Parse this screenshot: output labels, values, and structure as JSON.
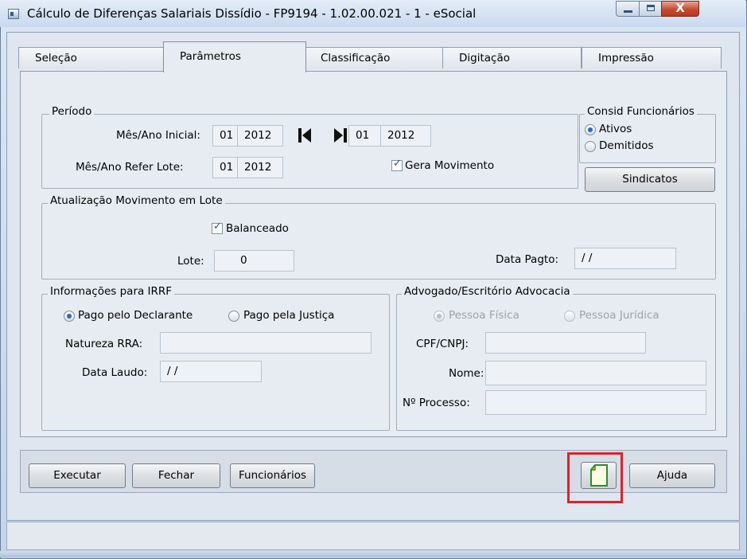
{
  "window": {
    "title": "Cálculo de Diferenças Salariais Dissídio - FP9194 - 1.02.00.021 - 1 - eSocial",
    "close_glyph": "X"
  },
  "tabs": [
    {
      "label": "Seleção",
      "active": false
    },
    {
      "label": "Parâmetros",
      "active": true
    },
    {
      "label": "Classificação",
      "active": false
    },
    {
      "label": "Digitação",
      "active": false
    },
    {
      "label": "Impressão",
      "active": false
    }
  ],
  "periodo": {
    "title": "Período",
    "inicial_label": "Mês/Ano Inicial:",
    "inicial_mes": "01",
    "inicial_ano": "2012",
    "final_mes": "01",
    "final_ano": "2012",
    "refer_label": "Mês/Ano Refer Lote:",
    "refer_mes": "01",
    "refer_ano": "2012",
    "gera_movimento_label": "Gera Movimento",
    "gera_movimento_checked": true
  },
  "consid_funcionarios": {
    "title": "Consid Funcionários",
    "options": [
      {
        "label": "Ativos",
        "selected": true
      },
      {
        "label": "Demitidos",
        "selected": false
      }
    ],
    "sindicatos_label": "Sindicatos"
  },
  "atualizacao": {
    "title": "Atualização Movimento em Lote",
    "balanceado_label": "Balanceado",
    "balanceado_checked": true,
    "lote_label": "Lote:",
    "lote_value": "0",
    "data_pagto_label": "Data Pagto:",
    "data_pagto_value": "/ /"
  },
  "irrf": {
    "title": "Informações para IRRF",
    "option_declarante": "Pago pelo Declarante",
    "option_justica": "Pago pela Justiça",
    "selected": "Pago pelo Declarante",
    "natureza_label": "Natureza RRA:",
    "natureza_value": "",
    "data_laudo_label": "Data Laudo:",
    "data_laudo_value": "/ /"
  },
  "advogado": {
    "title": "Advogado/Escritório Advocacia",
    "option_fisica": "Pessoa Física",
    "option_juridica": "Pessoa Jurídica",
    "selected": "Pessoa Física",
    "cpf_label": "CPF/CNPJ:",
    "cpf_value": "",
    "nome_label": "Nome:",
    "nome_value": "",
    "processo_label": "Nº Processo:",
    "processo_value": ""
  },
  "buttons": {
    "executar": "Executar",
    "fechar": "Fechar",
    "funcionarios": "Funcionários",
    "ajuda": "Ajuda"
  },
  "icons": {
    "first": "first-record-icon",
    "last": "last-record-icon",
    "document": "document-icon"
  },
  "colors": {
    "highlight": "#e0202a",
    "close_button": "#c74a32",
    "radio_selected": "#2f68b7"
  }
}
